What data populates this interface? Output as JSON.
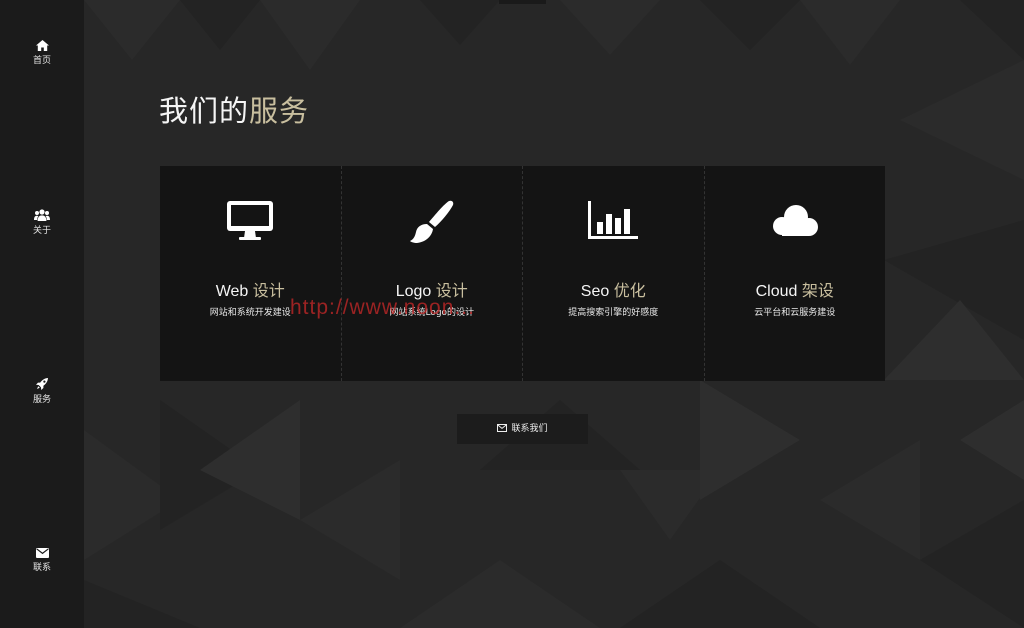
{
  "sidebar": {
    "items": [
      {
        "label": "首页",
        "icon": "home-icon"
      },
      {
        "label": "关于",
        "icon": "users-icon"
      },
      {
        "label": "服务",
        "icon": "rocket-icon"
      },
      {
        "label": "联系",
        "icon": "envelope-icon"
      }
    ]
  },
  "section": {
    "title_main": "我们的",
    "title_accent": "服务"
  },
  "services": [
    {
      "title": "Web",
      "title_accent": "设计",
      "desc": "网站和系统开发建设",
      "icon": "desktop-icon"
    },
    {
      "title": "Logo",
      "title_accent": "设计",
      "desc": "网站系统Logo的设计",
      "icon": "paintbrush-icon"
    },
    {
      "title": "Seo",
      "title_accent": "优化",
      "desc": "提高搜索引擎的好感度",
      "icon": "bar-chart-icon"
    },
    {
      "title": "Cloud",
      "title_accent": "架设",
      "desc": "云平台和云服务建设",
      "icon": "cloud-icon"
    }
  ],
  "contact_button": {
    "label": "联系我们",
    "icon": "envelope-icon"
  },
  "watermark": "http://www.noon...",
  "colors": {
    "accent": "#c9bf9f",
    "sidebar_bg": "#1b1b1b",
    "card_bg": "#141414",
    "page_bg": "#272727",
    "watermark": "#c82828"
  }
}
